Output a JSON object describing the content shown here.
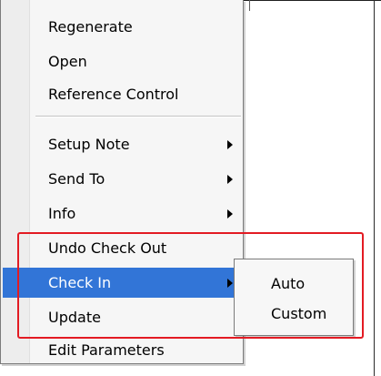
{
  "context_menu": {
    "items": [
      {
        "label": "Regenerate"
      },
      {
        "label": "Open"
      },
      {
        "label": "Reference Control"
      },
      {
        "label": "Setup Note"
      },
      {
        "label": "Send To"
      },
      {
        "label": "Info"
      },
      {
        "label": "Undo Check Out"
      },
      {
        "label": "Check In"
      },
      {
        "label": "Update"
      },
      {
        "label": "Edit Parameters"
      }
    ]
  },
  "submenu": {
    "items": [
      {
        "label": "Auto"
      },
      {
        "label": "Custom"
      }
    ]
  },
  "colors": {
    "highlight_active": "#3275d7",
    "annotation_red": "#e31b23"
  },
  "icons": {
    "submenu_arrow": "triangle-right"
  }
}
